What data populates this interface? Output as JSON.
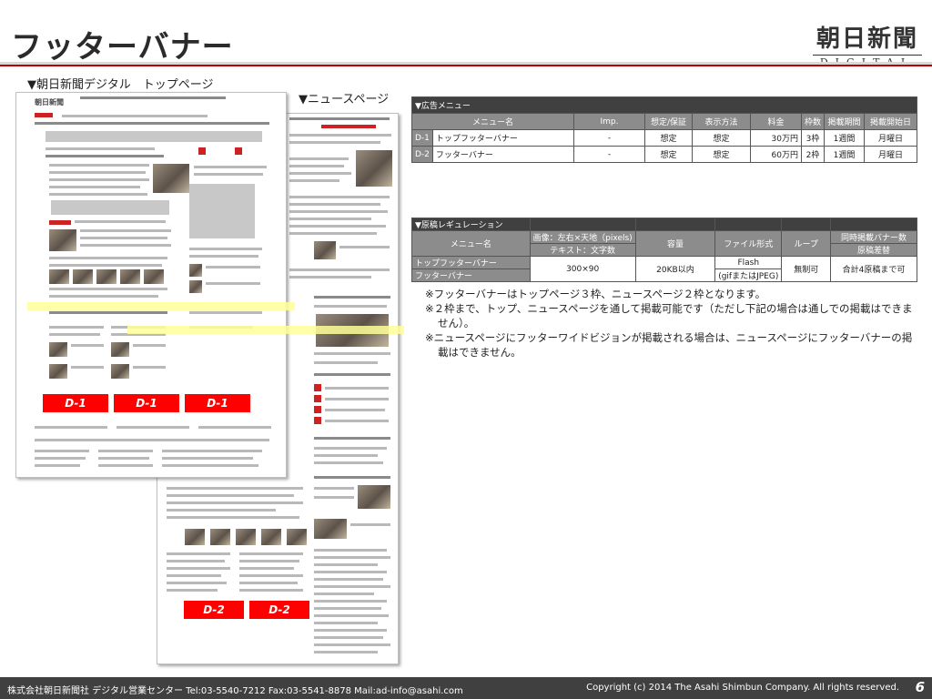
{
  "header": {
    "title": "フッターバナー",
    "logo_main": "朝日新聞",
    "logo_sub": "DIGITAL"
  },
  "captions": {
    "top_page": "▼朝日新聞デジタル　トップページ",
    "news_page": "▼ニュースページ"
  },
  "banners": {
    "top": [
      "D-1",
      "D-1",
      "D-1"
    ],
    "news": [
      "D-2",
      "D-2"
    ]
  },
  "menu_table": {
    "caption": "▼広告メニュー",
    "headers": [
      "メニュー名",
      "Imp.",
      "想定/保証",
      "表示方法",
      "料金",
      "枠数",
      "掲載期間",
      "掲載開始日"
    ],
    "rows": [
      {
        "id": "D-1",
        "name": "トップフッターバナー",
        "imp": "-",
        "guarantee": "想定",
        "display": "想定",
        "price": "30万円",
        "slots": "3枠",
        "period": "1週間",
        "start": "月曜日"
      },
      {
        "id": "D-2",
        "name": "フッターバナー",
        "imp": "-",
        "guarantee": "想定",
        "display": "想定",
        "price": "60万円",
        "slots": "2枠",
        "period": "1週間",
        "start": "月曜日"
      }
    ]
  },
  "reg_table": {
    "caption": "▼原稿レギュレーション",
    "menu_label": "メニュー名",
    "image_label": "画像：左右×天地（pixels)",
    "text_label": "テキスト：文字数",
    "capacity_label": "容量",
    "format_label": "ファイル形式",
    "loop_label": "ループ",
    "sim_label": "同時掲載バナー数",
    "rotation_label": "原稿差替",
    "row_names": [
      "トップフッターバナー",
      "フッターバナー"
    ],
    "size": "300×90",
    "capacity": "20KB以内",
    "format_flash": "Flash",
    "format_image": "(gifまたはJPEG)",
    "loop": "無制可",
    "rotation": "合計4原稿まで可"
  },
  "notes": [
    "※フッターバナーはトップページ３枠、ニュースページ２枠となります。",
    "※２枠まで、トップ、ニュースページを通して掲載可能です（ただし下記の場合は通しでの掲載はできません）。",
    "※ニュースページにフッターワイドビジョンが掲載される場合は、ニュースページにフッターバナーの掲載はできません。"
  ],
  "footer": {
    "left": "株式会社朝日新聞社  デジタル営業センター   Tel:03-5540-7212   Fax:03-5541-8878   Mail:ad-info@asahi.com",
    "right": "Copyright (c) 2014 The Asahi Shimbun Company. All rights reserved.",
    "page": "6"
  },
  "colors": {
    "banner_red": "#ff0000",
    "highlight_yellow": "#ffff99",
    "table_dark": "#404040",
    "table_header": "#8c8c8c",
    "rule_red": "#c00000"
  }
}
